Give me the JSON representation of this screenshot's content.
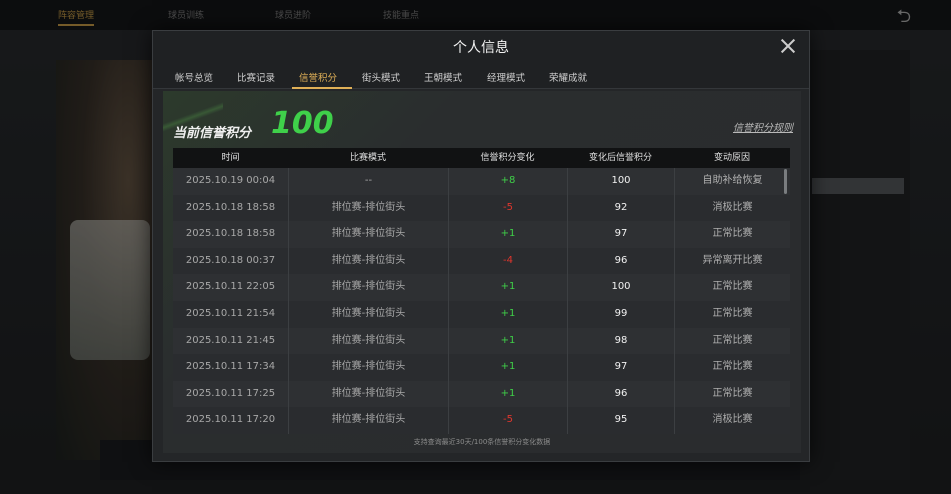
{
  "background": {
    "tabs": [
      "阵容管理",
      "球员训练",
      "球员进阶",
      "技能重点"
    ],
    "back_icon": "undo-icon"
  },
  "modal": {
    "title": "个人信息",
    "close_icon": "close-icon",
    "tabs": [
      {
        "label": "帐号总览"
      },
      {
        "label": "比赛记录"
      },
      {
        "label": "信誉积分"
      },
      {
        "label": "街头模式"
      },
      {
        "label": "王朝模式"
      },
      {
        "label": "经理模式"
      },
      {
        "label": "荣耀成就"
      }
    ],
    "active_tab": "信誉积分"
  },
  "credit": {
    "label": "当前信誉积分",
    "value": "100",
    "rules_link": "信誉积分规则",
    "columns": [
      "时间",
      "比赛模式",
      "信誉积分变化",
      "变化后信誉积分",
      "变动原因"
    ],
    "rows": [
      {
        "time": "2025.10.19  00:04",
        "mode": "--",
        "delta": "+8",
        "after": "100",
        "reason": "自助补给恢复"
      },
      {
        "time": "2025.10.18  18:58",
        "mode": "排位赛-排位街头",
        "delta": "-5",
        "after": "92",
        "reason": "消极比赛"
      },
      {
        "time": "2025.10.18  18:58",
        "mode": "排位赛-排位街头",
        "delta": "+1",
        "after": "97",
        "reason": "正常比赛"
      },
      {
        "time": "2025.10.18  00:37",
        "mode": "排位赛-排位街头",
        "delta": "-4",
        "after": "96",
        "reason": "异常离开比赛"
      },
      {
        "time": "2025.10.11  22:05",
        "mode": "排位赛-排位街头",
        "delta": "+1",
        "after": "100",
        "reason": "正常比赛"
      },
      {
        "time": "2025.10.11  21:54",
        "mode": "排位赛-排位街头",
        "delta": "+1",
        "after": "99",
        "reason": "正常比赛"
      },
      {
        "time": "2025.10.11  21:45",
        "mode": "排位赛-排位街头",
        "delta": "+1",
        "after": "98",
        "reason": "正常比赛"
      },
      {
        "time": "2025.10.11  17:34",
        "mode": "排位赛-排位街头",
        "delta": "+1",
        "after": "97",
        "reason": "正常比赛"
      },
      {
        "time": "2025.10.11  17:25",
        "mode": "排位赛-排位街头",
        "delta": "+1",
        "after": "96",
        "reason": "正常比赛"
      },
      {
        "time": "2025.10.11  17:20",
        "mode": "排位赛-排位街头",
        "delta": "-5",
        "after": "95",
        "reason": "消极比赛"
      }
    ],
    "footnote": "支持查询最近30天/100条信誉积分变化数据"
  },
  "colors": {
    "accent": "#e0b057",
    "positive": "#3fcf48",
    "negative": "#e0362d",
    "score": "#3fd04a"
  }
}
